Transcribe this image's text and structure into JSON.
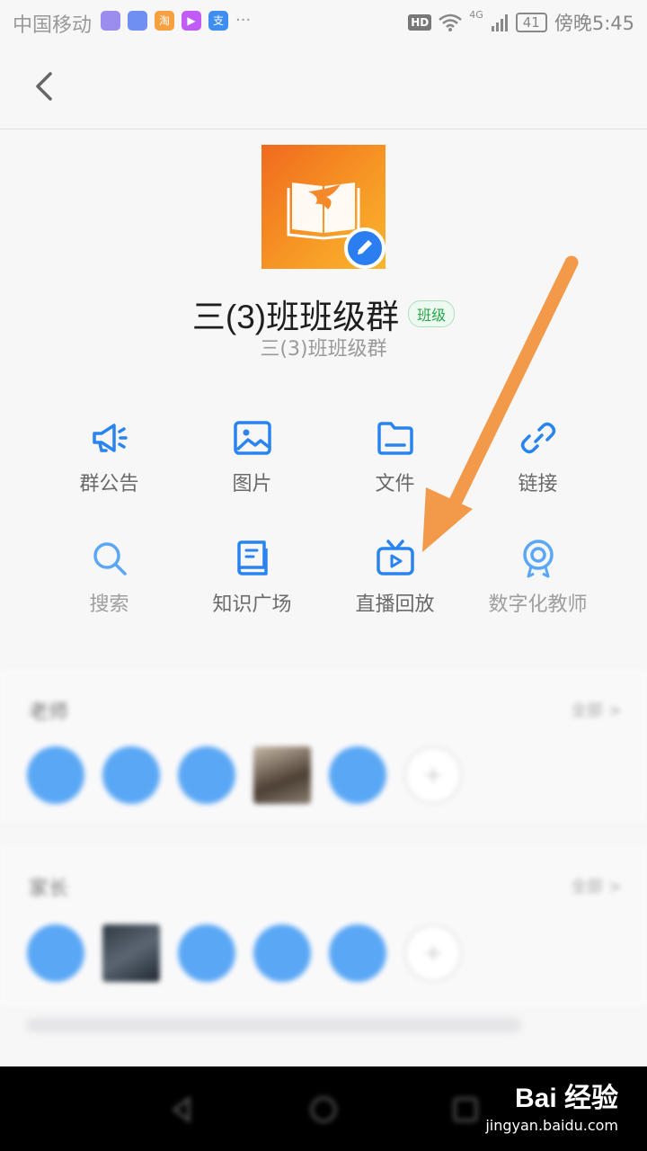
{
  "status_bar": {
    "carrier": "中国移动",
    "apps": [
      {
        "name": "app-icon-1",
        "label": "",
        "color": "#9b8cf0"
      },
      {
        "name": "app-icon-2",
        "label": "",
        "color": "#6f8ff2"
      },
      {
        "name": "taobao-icon",
        "label": "淘",
        "color": "#f7a040"
      },
      {
        "name": "video-play-icon",
        "label": "▶",
        "color": "#c05bf5"
      },
      {
        "name": "alipay-icon",
        "label": "支",
        "color": "#3d8ef0"
      }
    ],
    "more": "···",
    "hd": "HD",
    "network": "4G",
    "battery": "41",
    "time": "傍晚5:45"
  },
  "group": {
    "name": "三(3)班班级群",
    "tag": "班级",
    "subtitle": "三(3)班班级群"
  },
  "features": [
    {
      "label": "群公告",
      "icon": "megaphone-icon",
      "faded": false
    },
    {
      "label": "图片",
      "icon": "image-icon",
      "faded": false
    },
    {
      "label": "文件",
      "icon": "folder-icon",
      "faded": false
    },
    {
      "label": "链接",
      "icon": "link-icon",
      "faded": false
    },
    {
      "label": "搜索",
      "icon": "search-icon",
      "faded": true
    },
    {
      "label": "知识广场",
      "icon": "book-icon",
      "faded": false
    },
    {
      "label": "直播回放",
      "icon": "tv-replay-icon",
      "faded": false
    },
    {
      "label": "数字化教师",
      "icon": "badge-award-icon",
      "faded": true
    }
  ],
  "sections": {
    "members1": {
      "title": "老师",
      "more": "全部 >"
    },
    "members2": {
      "title": "家长",
      "more": "全部 >"
    }
  },
  "watermark": {
    "logo": "Bai 经验",
    "url": "jingyan.baidu.com"
  },
  "colors": {
    "accent": "#2a84f0",
    "tag_green": "#26a64a",
    "arrow": "#f29a4a"
  }
}
